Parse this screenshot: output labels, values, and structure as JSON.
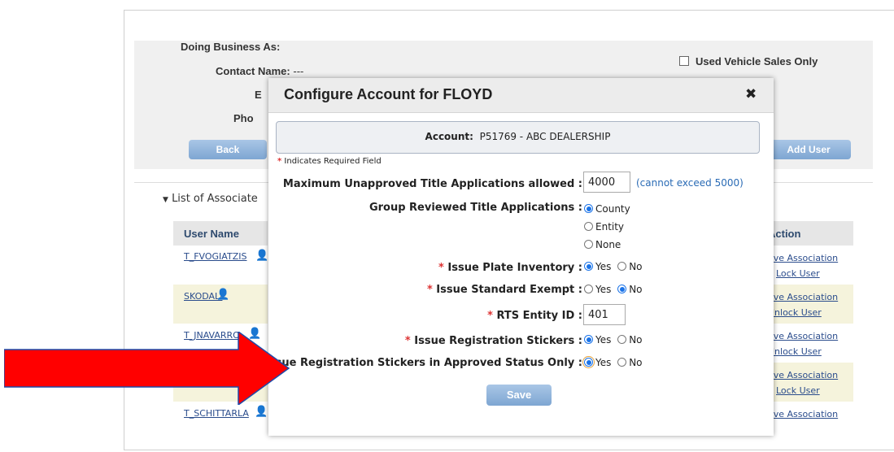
{
  "background": {
    "doing_business_as": "Doing Business As:",
    "contact_name_label": "Contact Name:",
    "contact_name_value": "---",
    "email_label_fragment": "E",
    "phone_label_fragment": "Pho",
    "used_vehicle_label": "Used Vehicle Sales Only",
    "back_button": "Back",
    "add_user_button": "Add User",
    "section_title": "List of Associate",
    "table": {
      "user_name_header": "User Name",
      "action_header": "Action",
      "rows": [
        {
          "user": "T_FVOGIATZIS",
          "action1": "ove Association",
          "action2": "Lock User"
        },
        {
          "user": "SKODALI",
          "action1": "ove Association",
          "action2": "Unlock User"
        },
        {
          "user": "T_JNAVARRO",
          "action1": "ove Association",
          "action2": "Unlock User"
        },
        {
          "user": "",
          "action1": "ove Association",
          "action2": "Lock User"
        },
        {
          "user": "T_SCHITTARLA",
          "action1": "ove Association",
          "action2": ""
        }
      ]
    }
  },
  "modal": {
    "title": "Configure Account for FLOYD",
    "close_symbol": "✖",
    "account_label": "Account:",
    "account_value": "P51769 - ABC DEALERSHIP",
    "required_note": "Indicates Required Field",
    "required_symbol": "*",
    "max_unapproved_label": "Maximum Unapproved Title Applications allowed :",
    "max_unapproved_value": "4000",
    "max_unapproved_hint": "(cannot exceed 5000)",
    "group_reviewed_label": "Group Reviewed Title Applications :",
    "group_options": [
      "County",
      "Entity",
      "None"
    ],
    "group_selected": "County",
    "plate_inventory_label": "Issue Plate Inventory :",
    "standard_exempt_label": "Issue Standard Exempt :",
    "rts_entity_label": "RTS Entity ID :",
    "rts_entity_value": "401",
    "reg_stickers_label": "Issue Registration Stickers :",
    "reg_stickers_approved_label": "Issue Registration Stickers in Approved Status Only :",
    "yes_label": "Yes",
    "no_label": "No",
    "save_button": "Save"
  },
  "colors": {
    "arrow": "#ff0000",
    "button_blue": "#8fb3d9",
    "radio_selected": "#1a73e8"
  }
}
